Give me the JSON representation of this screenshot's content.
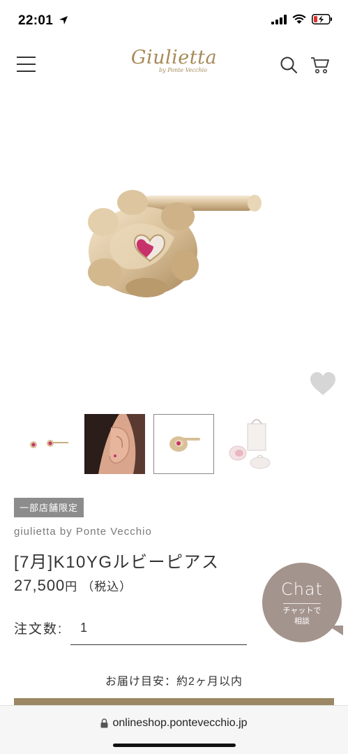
{
  "status_bar": {
    "time": "22:01",
    "icons": [
      "location-arrow-icon",
      "signal-icon",
      "wifi-icon",
      "battery-icon"
    ]
  },
  "header": {
    "logo_main": "Giulietta",
    "logo_sub": "by Ponte Vecchio",
    "icons": [
      "menu-icon",
      "search-icon",
      "cart-icon"
    ]
  },
  "product": {
    "badge": "一部店舗限定",
    "brand": "giulietta by Ponte Vecchio",
    "name": "[7月]K10YGルビーピアス",
    "price_value": "27,500",
    "price_unit": "円",
    "price_tax": "（税込）"
  },
  "thumbnails": [
    {
      "alt": "earring-pair",
      "selected": false
    },
    {
      "alt": "earring-worn-on-ear",
      "selected": false
    },
    {
      "alt": "earring-closeup",
      "selected": true
    },
    {
      "alt": "packaging",
      "selected": false
    }
  ],
  "chat": {
    "title": "Chat",
    "line1": "チャットで",
    "line2": "相談"
  },
  "quantity": {
    "label": "注文数:",
    "value": "1"
  },
  "delivery": "お届け目安：約2ヶ月以内",
  "browser": {
    "url": "onlineshop.pontevecchio.jp"
  },
  "colors": {
    "accent_gold": "#a68a58",
    "chat_bg": "#a4948e",
    "badge_bg": "#8c8c8c",
    "cart_button": "#9b8764"
  }
}
